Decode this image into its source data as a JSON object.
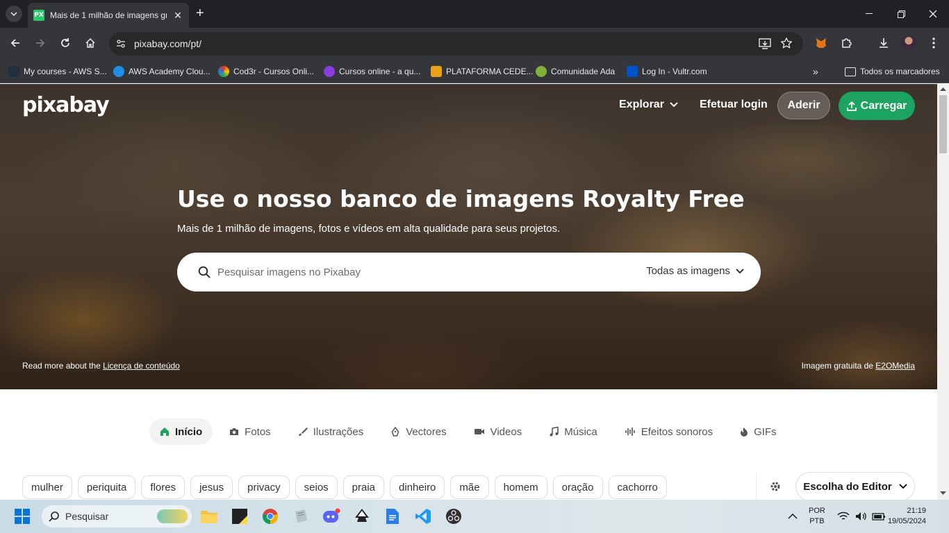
{
  "browser": {
    "tab_title": "Mais de 1 milhão de imagens gr",
    "tab_favicon_text": "PX",
    "url": "pixabay.com/pt/",
    "bookmarks": [
      {
        "label": "My courses - AWS S...",
        "color": "#232f3e"
      },
      {
        "label": "AWS Academy Clou...",
        "color": "#1f8ee6"
      },
      {
        "label": "Cod3r - Cursos Onli...",
        "color": "#e6352b"
      },
      {
        "label": "Cursos online - a qu...",
        "color": "#8c3be0"
      },
      {
        "label": "PLATAFORMA CEDE...",
        "color": "#e8a317"
      },
      {
        "label": "Comunidade Ada",
        "color": "#7fb03a"
      },
      {
        "label": "Log In - Vultr.com",
        "color": "#0052cc"
      }
    ],
    "all_bookmarks": "Todos os marcadores"
  },
  "site": {
    "logo": "pixabay",
    "nav": {
      "explore": "Explorar",
      "login": "Efetuar login",
      "join": "Aderir",
      "upload": "Carregar"
    },
    "hero": {
      "title": "Use o nosso banco de imagens Royalty Free",
      "subtitle": "Mais de 1 milhão de imagens, fotos e vídeos em alta qualidade para seus projetos.",
      "search_placeholder": "Pesquisar imagens no Pixabay",
      "search_filter": "Todas as imagens",
      "license_prefix": "Read more about the",
      "license_link": "Licença de conteúdo",
      "credit_prefix": "Imagem gratuita de",
      "credit_link": "E2OMedia"
    },
    "categories": [
      {
        "label": "Início",
        "icon": "home-icon",
        "active": true
      },
      {
        "label": "Fotos",
        "icon": "camera-icon",
        "active": false
      },
      {
        "label": "Ilustrações",
        "icon": "brush-icon",
        "active": false
      },
      {
        "label": "Vectores",
        "icon": "pen-nib-icon",
        "active": false
      },
      {
        "label": "Videos",
        "icon": "video-icon",
        "active": false
      },
      {
        "label": "Música",
        "icon": "music-note-icon",
        "active": false
      },
      {
        "label": "Efeitos sonoros",
        "icon": "waveform-icon",
        "active": false
      },
      {
        "label": "GIFs",
        "icon": "flame-icon",
        "active": false
      }
    ],
    "tags": [
      "mulher",
      "periquita",
      "flores",
      "jesus",
      "privacy",
      "seios",
      "praia",
      "dinheiro",
      "mãe",
      "homem",
      "oração",
      "cachorro"
    ],
    "sort": "Escolha do Editor",
    "accent": "#1ca361"
  },
  "taskbar": {
    "search_placeholder": "Pesquisar",
    "lang_top": "POR",
    "lang_bottom": "PTB",
    "time": "21:19",
    "date": "19/05/2024"
  }
}
